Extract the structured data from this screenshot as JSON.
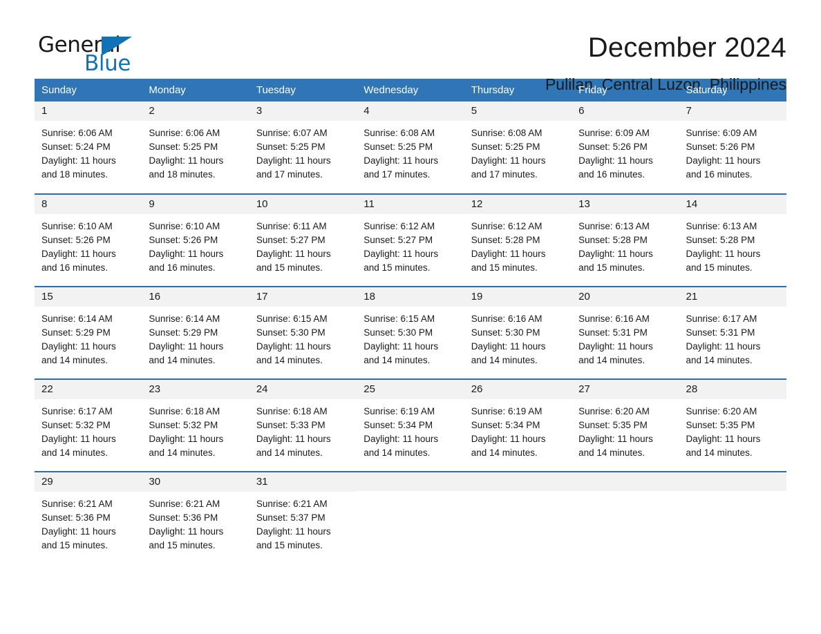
{
  "brand": {
    "name_part1": "General",
    "name_part2": "Blue",
    "triangle_color": "#1272b8"
  },
  "header": {
    "title": "December 2024",
    "subtitle": "Pulilan, Central Luzon, Philippines",
    "accent_color": "#3075b5",
    "row_divider_color": "#2e6da4",
    "daynum_background": "#f2f2f2"
  },
  "weekday_headers": [
    "Sunday",
    "Monday",
    "Tuesday",
    "Wednesday",
    "Thursday",
    "Friday",
    "Saturday"
  ],
  "labels": {
    "sunrise_prefix": "Sunrise:",
    "sunset_prefix": "Sunset:",
    "daylight_prefix": "Daylight:"
  },
  "weeks": [
    [
      {
        "day": "1",
        "sunrise": "Sunrise: 6:06 AM",
        "sunset": "Sunset: 5:24 PM",
        "daylight_line1": "Daylight: 11 hours",
        "daylight_line2": "and 18 minutes."
      },
      {
        "day": "2",
        "sunrise": "Sunrise: 6:06 AM",
        "sunset": "Sunset: 5:25 PM",
        "daylight_line1": "Daylight: 11 hours",
        "daylight_line2": "and 18 minutes."
      },
      {
        "day": "3",
        "sunrise": "Sunrise: 6:07 AM",
        "sunset": "Sunset: 5:25 PM",
        "daylight_line1": "Daylight: 11 hours",
        "daylight_line2": "and 17 minutes."
      },
      {
        "day": "4",
        "sunrise": "Sunrise: 6:08 AM",
        "sunset": "Sunset: 5:25 PM",
        "daylight_line1": "Daylight: 11 hours",
        "daylight_line2": "and 17 minutes."
      },
      {
        "day": "5",
        "sunrise": "Sunrise: 6:08 AM",
        "sunset": "Sunset: 5:25 PM",
        "daylight_line1": "Daylight: 11 hours",
        "daylight_line2": "and 17 minutes."
      },
      {
        "day": "6",
        "sunrise": "Sunrise: 6:09 AM",
        "sunset": "Sunset: 5:26 PM",
        "daylight_line1": "Daylight: 11 hours",
        "daylight_line2": "and 16 minutes."
      },
      {
        "day": "7",
        "sunrise": "Sunrise: 6:09 AM",
        "sunset": "Sunset: 5:26 PM",
        "daylight_line1": "Daylight: 11 hours",
        "daylight_line2": "and 16 minutes."
      }
    ],
    [
      {
        "day": "8",
        "sunrise": "Sunrise: 6:10 AM",
        "sunset": "Sunset: 5:26 PM",
        "daylight_line1": "Daylight: 11 hours",
        "daylight_line2": "and 16 minutes."
      },
      {
        "day": "9",
        "sunrise": "Sunrise: 6:10 AM",
        "sunset": "Sunset: 5:26 PM",
        "daylight_line1": "Daylight: 11 hours",
        "daylight_line2": "and 16 minutes."
      },
      {
        "day": "10",
        "sunrise": "Sunrise: 6:11 AM",
        "sunset": "Sunset: 5:27 PM",
        "daylight_line1": "Daylight: 11 hours",
        "daylight_line2": "and 15 minutes."
      },
      {
        "day": "11",
        "sunrise": "Sunrise: 6:12 AM",
        "sunset": "Sunset: 5:27 PM",
        "daylight_line1": "Daylight: 11 hours",
        "daylight_line2": "and 15 minutes."
      },
      {
        "day": "12",
        "sunrise": "Sunrise: 6:12 AM",
        "sunset": "Sunset: 5:28 PM",
        "daylight_line1": "Daylight: 11 hours",
        "daylight_line2": "and 15 minutes."
      },
      {
        "day": "13",
        "sunrise": "Sunrise: 6:13 AM",
        "sunset": "Sunset: 5:28 PM",
        "daylight_line1": "Daylight: 11 hours",
        "daylight_line2": "and 15 minutes."
      },
      {
        "day": "14",
        "sunrise": "Sunrise: 6:13 AM",
        "sunset": "Sunset: 5:28 PM",
        "daylight_line1": "Daylight: 11 hours",
        "daylight_line2": "and 15 minutes."
      }
    ],
    [
      {
        "day": "15",
        "sunrise": "Sunrise: 6:14 AM",
        "sunset": "Sunset: 5:29 PM",
        "daylight_line1": "Daylight: 11 hours",
        "daylight_line2": "and 14 minutes."
      },
      {
        "day": "16",
        "sunrise": "Sunrise: 6:14 AM",
        "sunset": "Sunset: 5:29 PM",
        "daylight_line1": "Daylight: 11 hours",
        "daylight_line2": "and 14 minutes."
      },
      {
        "day": "17",
        "sunrise": "Sunrise: 6:15 AM",
        "sunset": "Sunset: 5:30 PM",
        "daylight_line1": "Daylight: 11 hours",
        "daylight_line2": "and 14 minutes."
      },
      {
        "day": "18",
        "sunrise": "Sunrise: 6:15 AM",
        "sunset": "Sunset: 5:30 PM",
        "daylight_line1": "Daylight: 11 hours",
        "daylight_line2": "and 14 minutes."
      },
      {
        "day": "19",
        "sunrise": "Sunrise: 6:16 AM",
        "sunset": "Sunset: 5:30 PM",
        "daylight_line1": "Daylight: 11 hours",
        "daylight_line2": "and 14 minutes."
      },
      {
        "day": "20",
        "sunrise": "Sunrise: 6:16 AM",
        "sunset": "Sunset: 5:31 PM",
        "daylight_line1": "Daylight: 11 hours",
        "daylight_line2": "and 14 minutes."
      },
      {
        "day": "21",
        "sunrise": "Sunrise: 6:17 AM",
        "sunset": "Sunset: 5:31 PM",
        "daylight_line1": "Daylight: 11 hours",
        "daylight_line2": "and 14 minutes."
      }
    ],
    [
      {
        "day": "22",
        "sunrise": "Sunrise: 6:17 AM",
        "sunset": "Sunset: 5:32 PM",
        "daylight_line1": "Daylight: 11 hours",
        "daylight_line2": "and 14 minutes."
      },
      {
        "day": "23",
        "sunrise": "Sunrise: 6:18 AM",
        "sunset": "Sunset: 5:32 PM",
        "daylight_line1": "Daylight: 11 hours",
        "daylight_line2": "and 14 minutes."
      },
      {
        "day": "24",
        "sunrise": "Sunrise: 6:18 AM",
        "sunset": "Sunset: 5:33 PM",
        "daylight_line1": "Daylight: 11 hours",
        "daylight_line2": "and 14 minutes."
      },
      {
        "day": "25",
        "sunrise": "Sunrise: 6:19 AM",
        "sunset": "Sunset: 5:34 PM",
        "daylight_line1": "Daylight: 11 hours",
        "daylight_line2": "and 14 minutes."
      },
      {
        "day": "26",
        "sunrise": "Sunrise: 6:19 AM",
        "sunset": "Sunset: 5:34 PM",
        "daylight_line1": "Daylight: 11 hours",
        "daylight_line2": "and 14 minutes."
      },
      {
        "day": "27",
        "sunrise": "Sunrise: 6:20 AM",
        "sunset": "Sunset: 5:35 PM",
        "daylight_line1": "Daylight: 11 hours",
        "daylight_line2": "and 14 minutes."
      },
      {
        "day": "28",
        "sunrise": "Sunrise: 6:20 AM",
        "sunset": "Sunset: 5:35 PM",
        "daylight_line1": "Daylight: 11 hours",
        "daylight_line2": "and 14 minutes."
      }
    ],
    [
      {
        "day": "29",
        "sunrise": "Sunrise: 6:21 AM",
        "sunset": "Sunset: 5:36 PM",
        "daylight_line1": "Daylight: 11 hours",
        "daylight_line2": "and 15 minutes."
      },
      {
        "day": "30",
        "sunrise": "Sunrise: 6:21 AM",
        "sunset": "Sunset: 5:36 PM",
        "daylight_line1": "Daylight: 11 hours",
        "daylight_line2": "and 15 minutes."
      },
      {
        "day": "31",
        "sunrise": "Sunrise: 6:21 AM",
        "sunset": "Sunset: 5:37 PM",
        "daylight_line1": "Daylight: 11 hours",
        "daylight_line2": "and 15 minutes."
      },
      {
        "day": "",
        "sunrise": "",
        "sunset": "",
        "daylight_line1": "",
        "daylight_line2": ""
      },
      {
        "day": "",
        "sunrise": "",
        "sunset": "",
        "daylight_line1": "",
        "daylight_line2": ""
      },
      {
        "day": "",
        "sunrise": "",
        "sunset": "",
        "daylight_line1": "",
        "daylight_line2": ""
      },
      {
        "day": "",
        "sunrise": "",
        "sunset": "",
        "daylight_line1": "",
        "daylight_line2": ""
      }
    ]
  ]
}
